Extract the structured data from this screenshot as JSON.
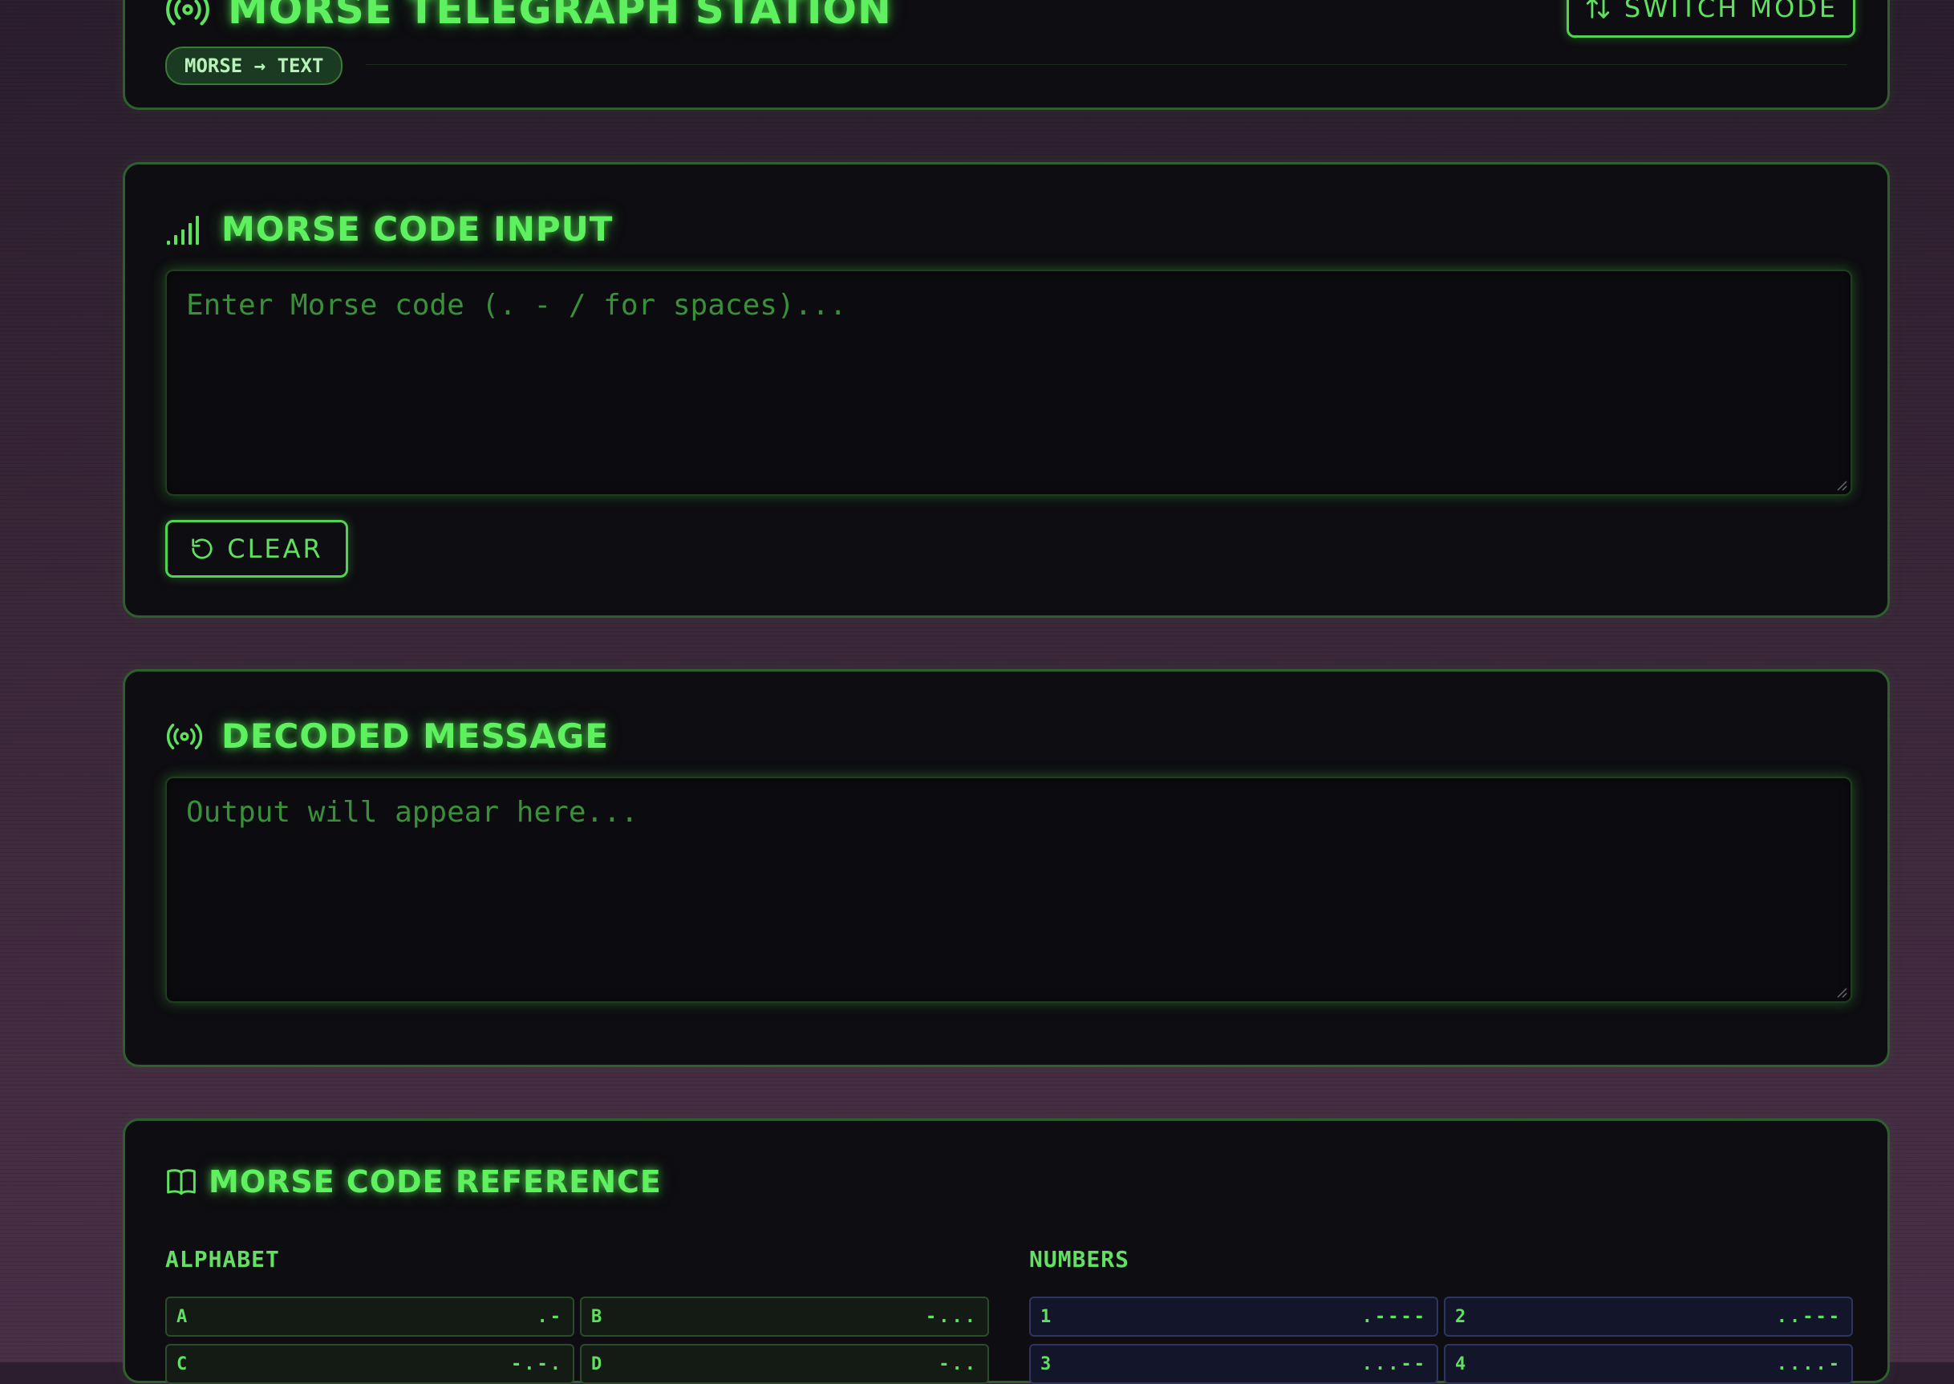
{
  "header": {
    "title": "MORSE TELEGRAPH STATION",
    "mode_badge": "MORSE → TEXT",
    "switch_button": "SWITCH MODE"
  },
  "input_panel": {
    "title": "MORSE CODE INPUT",
    "placeholder": "Enter Morse code (. - / for spaces)...",
    "clear_button": "CLEAR"
  },
  "output_panel": {
    "title": "DECODED MESSAGE",
    "placeholder": "Output will appear here..."
  },
  "reference": {
    "title": "MORSE CODE REFERENCE",
    "alphabet_label": "ALPHABET",
    "numbers_label": "NUMBERS",
    "alphabet": [
      {
        "char": "A",
        "code": ".-"
      },
      {
        "char": "B",
        "code": "-..."
      },
      {
        "char": "C",
        "code": "-.-."
      },
      {
        "char": "D",
        "code": "-.."
      }
    ],
    "numbers": [
      {
        "char": "1",
        "code": ".----"
      },
      {
        "char": "2",
        "code": "..---"
      },
      {
        "char": "3",
        "code": "...--"
      },
      {
        "char": "4",
        "code": "....-"
      }
    ]
  },
  "colors": {
    "accent": "#5fe05f",
    "panel_bg": "#0e0d11",
    "border": "#2f5f2f",
    "number_cell_border": "#2e3560"
  }
}
